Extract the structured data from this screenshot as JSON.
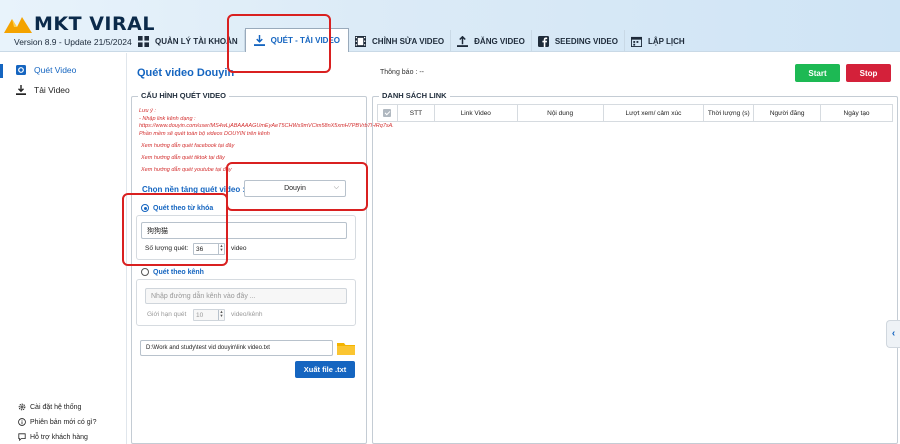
{
  "app": {
    "logo_text": "MKT VIRAL",
    "version": "Version 8.9 - Update 21/5/2024"
  },
  "nav": [
    {
      "label": "QUẢN LÝ TÀI KHOẢN",
      "icon": "grid-icon"
    },
    {
      "label": "QUÉT - TẢI VIDEO",
      "icon": "download-icon",
      "active": true
    },
    {
      "label": "CHỈNH SỬA VIDEO",
      "icon": "film-icon"
    },
    {
      "label": "ĐĂNG VIDEO",
      "icon": "upload-icon"
    },
    {
      "label": "SEEDING VIDEO",
      "icon": "facebook-icon"
    },
    {
      "label": "LẬP LỊCH",
      "icon": "calendar-icon"
    }
  ],
  "sidebar": {
    "items": [
      {
        "label": "Quét Video",
        "active": true
      },
      {
        "label": "Tải Video"
      }
    ],
    "bottom": [
      {
        "label": "Cài đặt hệ thống"
      },
      {
        "label": "Phiên bản mới có gì?"
      },
      {
        "label": "Hỗ trợ khách hàng"
      }
    ]
  },
  "main": {
    "title": "Quét video Douyin",
    "notice_label": "Thông báo :",
    "notice_value": "--",
    "start_label": "Start",
    "stop_label": "Stop"
  },
  "config": {
    "legend": "CẤU HÌNH QUÉT VIDEO",
    "note_title": "Lưu ý :",
    "note_line1": "- Nhập link kênh dạng :",
    "note_line2": "https://www.douyin.com/user/MS4wLjABAAAAGUmEyAeT5CHWs9mVCim58nX5xmH7PBVrb7lHRq7sA. Phần mềm sẽ quét toàn bộ videos DOUYIN trên kênh",
    "guide_facebook": "Xem hướng dẫn quét facebook tại đây",
    "guide_tiktok": "Xem hướng dẫn quét tiktok tại đây",
    "guide_youtube": "Xem hướng dẫn quét youtube tại đây",
    "platform_label": "Chọn nền tảng quét video :",
    "platform_value": "Douyin",
    "keyword_radio": "Quét theo từ khóa",
    "keyword_value": "狗狗猫",
    "scan_count_label": "Số lượng quét:",
    "scan_count_value": "36",
    "scan_count_unit": "video",
    "channel_radio": "Quét theo kênh",
    "channel_placeholder": "Nhập đường dẫn kênh vào đây ...",
    "limit_label": "Giới hạn quét",
    "limit_value": "10",
    "limit_unit": "video/kênh",
    "file_path": "D:\\Work and study\\test vid douyin\\link video.txt",
    "export_label": "Xuất file .txt"
  },
  "links": {
    "legend": "DANH SÁCH LINK",
    "columns": [
      "STT",
      "Link Video",
      "Nội dung",
      "Lượt xem/ cảm xúc",
      "Thời lượng (s)",
      "Người đăng",
      "Ngày tạo"
    ]
  },
  "colors": {
    "accent": "#1565c0",
    "start": "#1db954",
    "stop": "#d4213a",
    "annotation": "#d92020"
  }
}
